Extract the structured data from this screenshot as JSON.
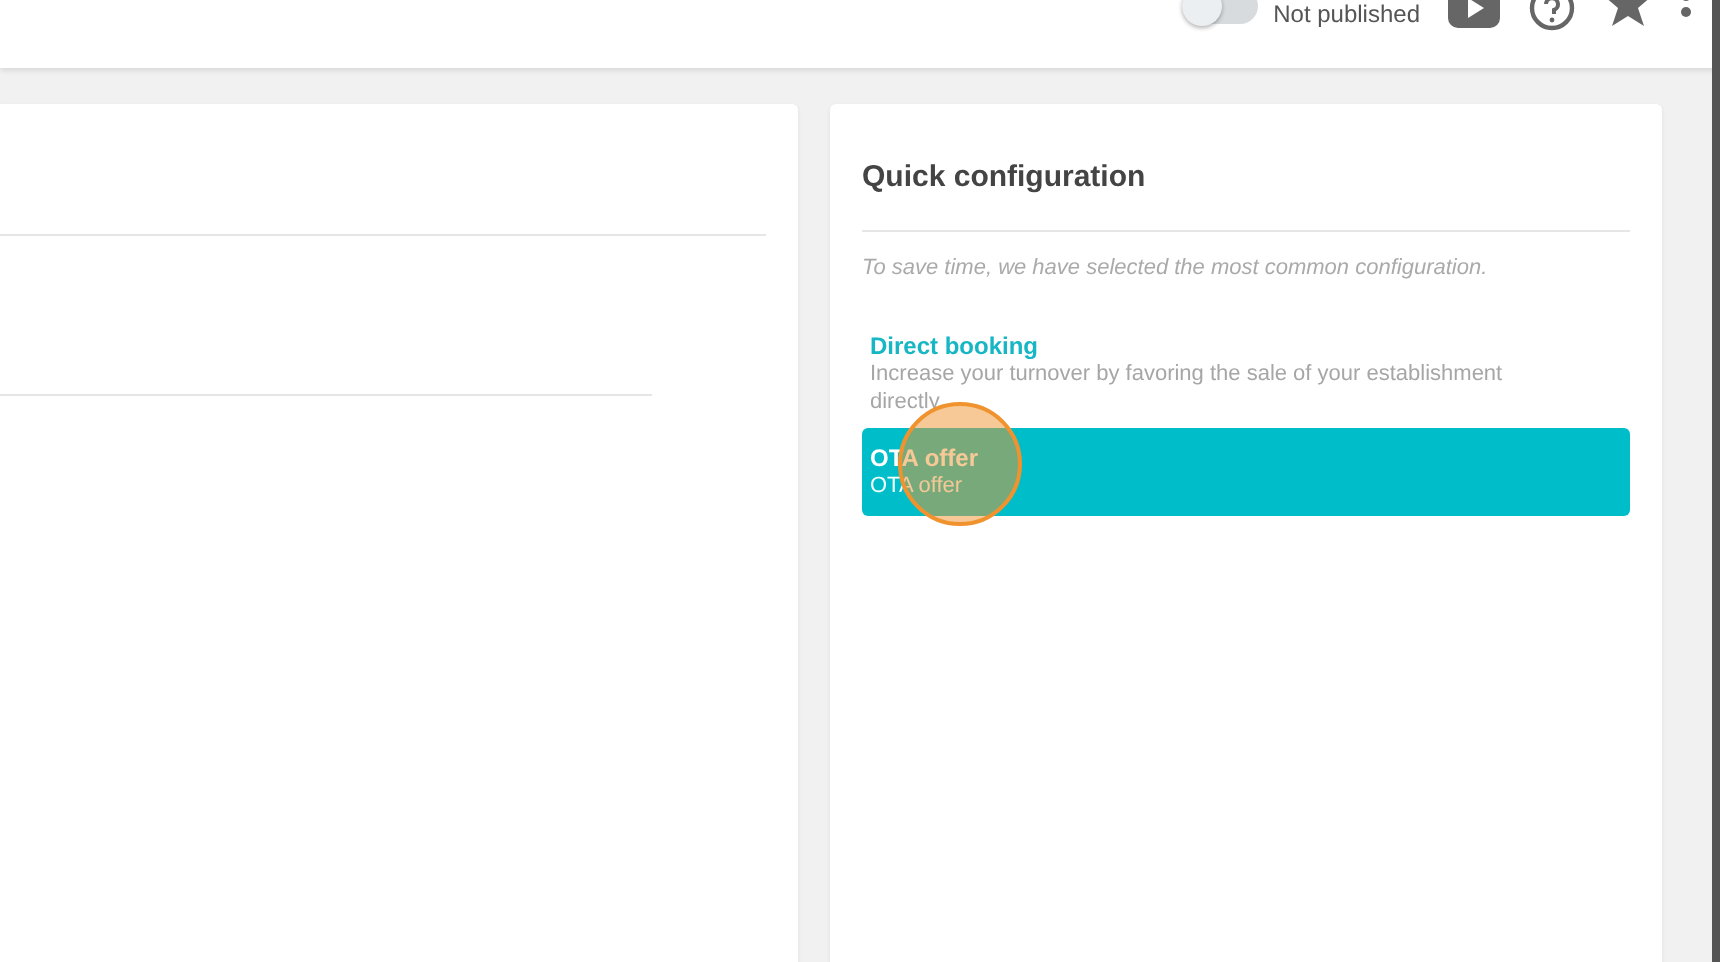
{
  "top_bar": {
    "publish_toggle": {
      "on": false,
      "label": "Not published"
    }
  },
  "quick_configuration": {
    "title": "Quick configuration",
    "hint": "To save time, we have selected the most common configuration.",
    "options": [
      {
        "title": "Direct booking",
        "description": "Increase your turnover by favoring the sale of your establishment directly.",
        "selected": false
      },
      {
        "title": "OTA offer",
        "description": "OTA offer",
        "selected": true
      }
    ]
  }
}
